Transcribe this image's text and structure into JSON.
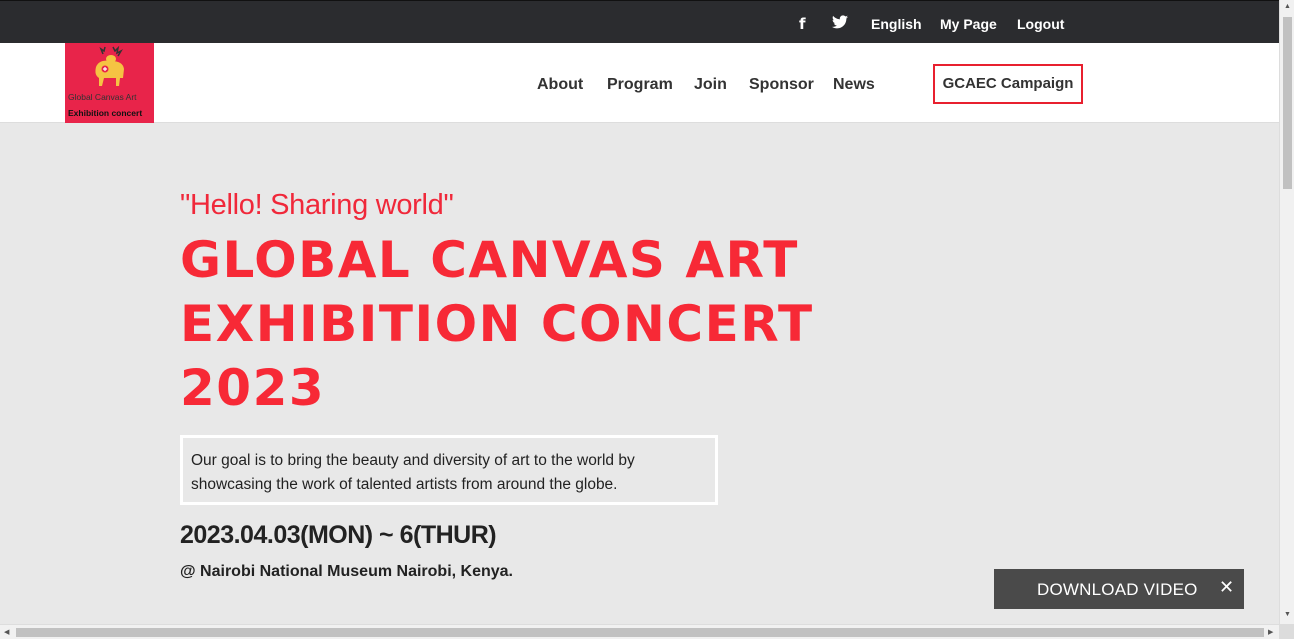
{
  "topbar": {
    "facebook_icon": "f",
    "twitter_icon": "twitter-bird",
    "language": "English",
    "my_page": "My Page",
    "logout": "Logout"
  },
  "logo": {
    "line1": "Global Canvas Art",
    "line2": "Exhibition concert",
    "background": "#e8244a"
  },
  "nav": {
    "items": [
      "About",
      "Program",
      "Join",
      "Sponsor",
      "News"
    ],
    "campaign": "GCAEC Campaign",
    "campaign_border": "#e8202f"
  },
  "hero": {
    "subtitle": "\"Hello! Sharing world\"",
    "title_line1": "GLOBAL CANVAS ART",
    "title_line2": "EXHIBITION CONCERT",
    "title_line3": "2023",
    "accent": "#f72936",
    "goal": "Our goal is to bring the beauty and diversity of art to the world by showcasing the work of talented artists from around the globe.",
    "date": "2023.04.03(MON) ~ 6(THUR)",
    "venue": "@ Nairobi National Museum Nairobi, Kenya."
  },
  "download": {
    "label": "DOWNLOAD VIDEO",
    "close": "✕"
  }
}
